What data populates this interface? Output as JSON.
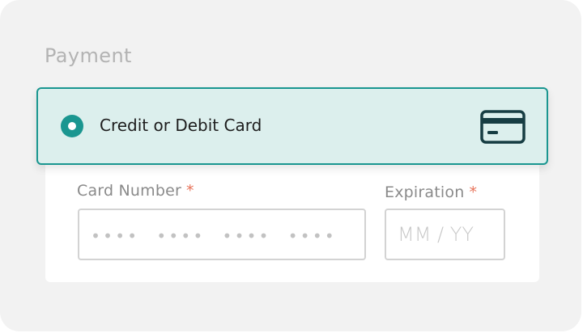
{
  "section": {
    "title": "Payment"
  },
  "payment_option": {
    "label": "Credit or Debit Card",
    "selected": true,
    "icon": "credit-card-icon"
  },
  "card_number": {
    "label": "Card Number",
    "required_mark": "*",
    "placeholder": "•••• •••• •••• ••••"
  },
  "expiration": {
    "label": "Expiration",
    "required_mark": "*",
    "placeholder": "MM / YY"
  },
  "colors": {
    "accent": "#1a9690",
    "selected_bg": "#dcefed",
    "required": "#e8735a",
    "icon": "#173d43"
  }
}
